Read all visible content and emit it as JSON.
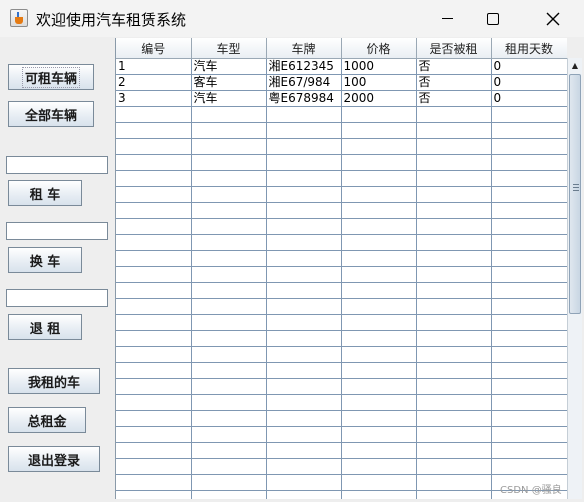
{
  "window": {
    "title": "欢迎使用汽车租赁系统",
    "icon": "java-cup-icon"
  },
  "sidebar": {
    "available_cars_label": "可租车辆",
    "all_cars_label": "全部车辆",
    "rent_input_value": "",
    "rent_label": "租 车",
    "swap_input_value": "",
    "swap_label": "换 车",
    "return_input_value": "",
    "return_label": "退 租",
    "my_rentals_label": "我租的车",
    "total_rent_label": "总租金",
    "logout_label": "退出登录"
  },
  "table": {
    "columns": [
      "编号",
      "车型",
      "车牌",
      "价格",
      "是否被租",
      "租用天数"
    ],
    "rows": [
      [
        "1",
        "汽车",
        "湘E612345",
        "1000",
        "否",
        "0"
      ],
      [
        "2",
        "客车",
        "湘E67/984",
        "100",
        "否",
        "0"
      ],
      [
        "3",
        "汽车",
        "粤E678984",
        "2000",
        "否",
        "0"
      ]
    ]
  },
  "watermark": "CSDN @骚良"
}
